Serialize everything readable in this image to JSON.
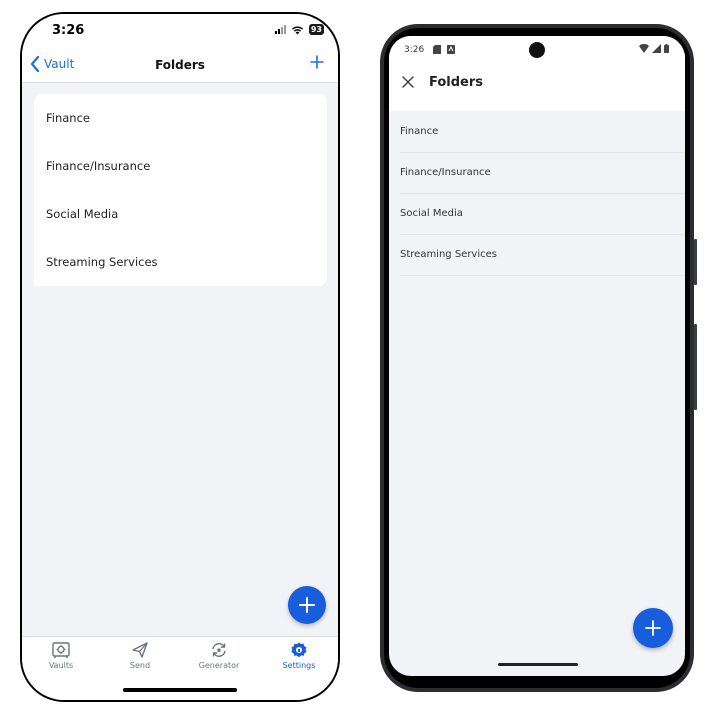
{
  "ios": {
    "status": {
      "time": "3:26",
      "battery": "93"
    },
    "nav": {
      "back_label": "Vault",
      "title": "Folders"
    },
    "folders": [
      "Finance",
      "Finance/Insurance",
      "Social Media",
      "Streaming Services"
    ],
    "tabs": [
      {
        "label": "Vaults",
        "icon": "vault-icon"
      },
      {
        "label": "Send",
        "icon": "send-icon"
      },
      {
        "label": "Generator",
        "icon": "generator-icon"
      },
      {
        "label": "Settings",
        "icon": "settings-icon"
      }
    ],
    "active_tab": "Settings"
  },
  "android": {
    "status": {
      "time": "3:26"
    },
    "nav": {
      "title": "Folders"
    },
    "folders": [
      "Finance",
      "Finance/Insurance",
      "Social Media",
      "Streaming Services"
    ]
  },
  "colors": {
    "accent": "#175ddc",
    "link": "#1a6fe6",
    "background": "#f1f3f6"
  }
}
